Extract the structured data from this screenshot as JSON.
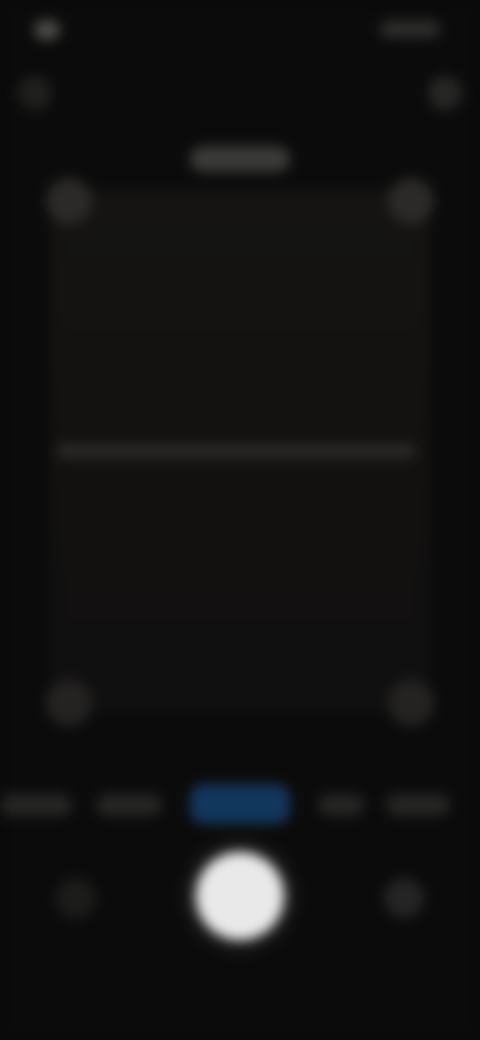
{
  "status_bar": {
    "time": "",
    "right_indicator": ""
  },
  "viewfinder": {
    "title": ""
  },
  "modes": [
    {
      "label": ""
    },
    {
      "label": ""
    },
    {
      "label": ""
    },
    {
      "label": ""
    },
    {
      "label": ""
    }
  ],
  "colors": {
    "background": "#0b0b0b",
    "active_mode": "#12375c",
    "shutter": "#e9e9e9"
  },
  "icons": {
    "top_left": "flash-icon",
    "top_right": "settings-icon",
    "bottom_left": "gallery-icon",
    "bottom_right": "switch-camera-icon"
  }
}
